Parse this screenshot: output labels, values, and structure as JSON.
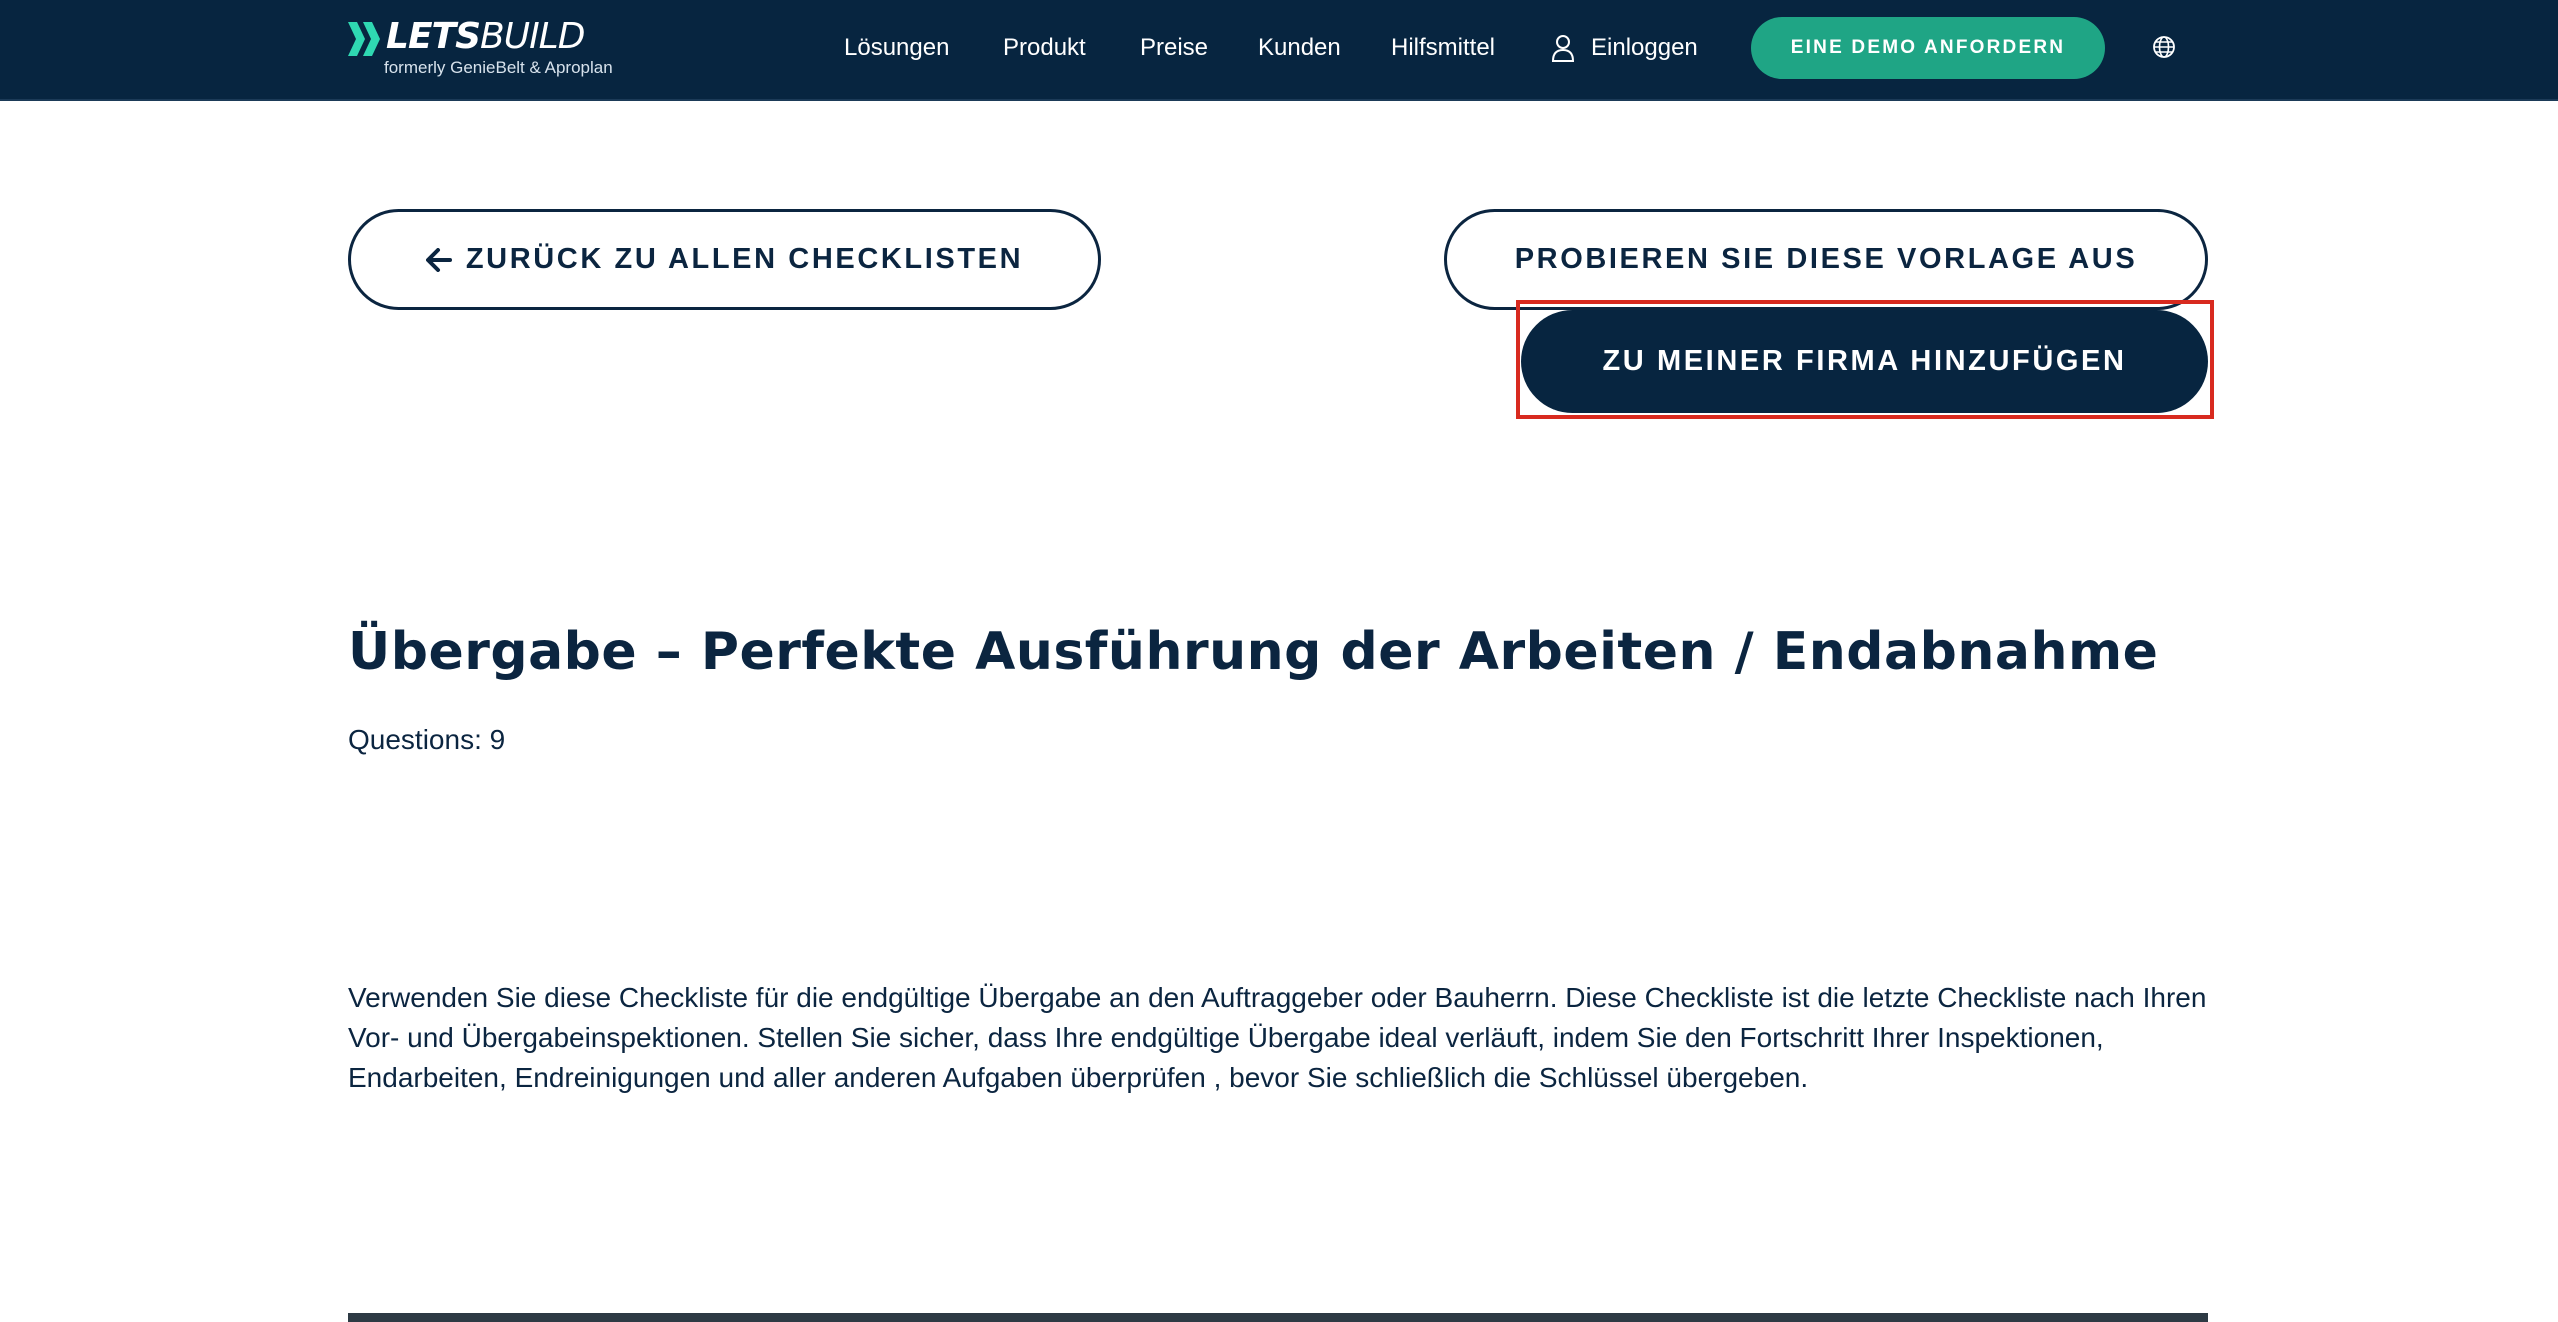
{
  "header": {
    "brand_bold": "LETS",
    "brand_light": "BUILD",
    "brand_tagline": "formerly GenieBelt & Aproplan",
    "nav": [
      "Lösungen",
      "Produkt",
      "Preise",
      "Kunden",
      "Hilfsmittel"
    ],
    "login_label": "Einloggen",
    "demo_label": "EINE DEMO ANFORDERN",
    "colors": {
      "nav_bg": "#072540",
      "accent": "#1fa585",
      "logo_mark": "#2fd8b2"
    }
  },
  "actions": {
    "back_label": "ZURÜCK ZU ALLEN CHECKLISTEN",
    "try_label": "PROBIEREN SIE DIESE VORLAGE AUS",
    "add_label": "ZU MEINER FIRMA HINZUFÜGEN",
    "highlight_color": "#d82a1f"
  },
  "checklist": {
    "title": "Übergabe – Perfekte Ausführung der Arbeiten / Endabnahme",
    "questions_label": "Questions: 9",
    "description": "Verwenden Sie diese Checkliste für die endgültige Übergabe an den Auftraggeber oder Bauherrn. Diese Checkliste ist die letzte Checkliste nach Ihren Vor- und Übergabeinspektionen. Stellen Sie sicher, dass Ihre endgültige Übergabe ideal verläuft, indem Sie den Fortschritt Ihrer Inspektionen, Endarbeiten, Endreinigungen und aller anderen Aufgaben überprüfen , bevor Sie schließlich die Schlüssel übergeben."
  }
}
